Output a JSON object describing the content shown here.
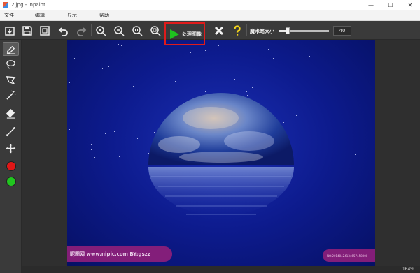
{
  "window": {
    "title": "2.jpg - Inpaint",
    "minimize": "—",
    "maximize": "☐",
    "close": "✕"
  },
  "menu": {
    "items": [
      "文件",
      "编辑",
      "显示",
      "帮助"
    ]
  },
  "toolbar": {
    "process_label": "处理图像",
    "brush_size_label": "魔术笔大小",
    "brush_size_value": "40",
    "brush_size_fraction": 0.18
  },
  "watermark": {
    "left_text": "昵图网 www.nipic.com    BY:gszz",
    "right_text": "NO:20140424134657458000"
  },
  "status": {
    "zoom": "164%"
  },
  "colors": {
    "accent_red": "#e01b1b",
    "marker_red": "#e01717",
    "marker_green": "#21c51f",
    "play_green": "#1fc21f",
    "help_yellow": "#f5d61a"
  }
}
